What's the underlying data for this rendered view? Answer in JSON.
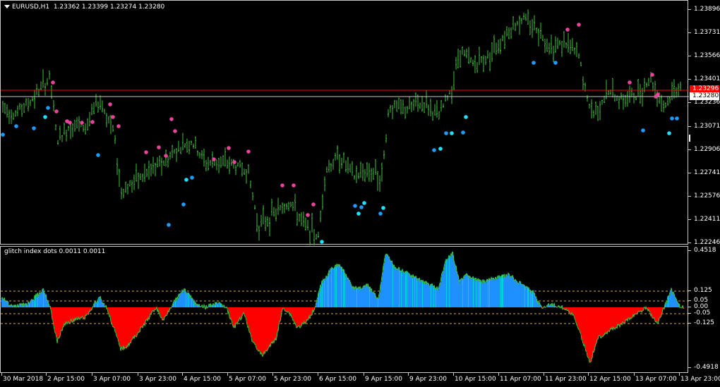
{
  "chart": {
    "symbol_label": "EURUSD,H1  1.23362 1.23399 1.23274 1.23280",
    "indicator_label": "glitch index dots 0.0011 0.0011",
    "bar_color": "#3cc33c",
    "colors": {
      "pink": "#e8449b",
      "blue": "#1e9bff",
      "cyan": "#1fe0ff",
      "bid_line": "#c8c8c8",
      "ask_line": "#ff0000",
      "hist_pos": "#1e90ff",
      "hist_pos_alt": "#00d0e0",
      "hist_neg": "#ff0000",
      "hist_line": "#3cc33c",
      "level_line": "#d9a441"
    },
    "price_ticks": [
      "1.23896",
      "1.23731",
      "1.23566",
      "1.23401",
      "1.23236",
      "1.23071",
      "1.22906",
      "1.22741",
      "1.22576",
      "1.22411",
      "1.22246"
    ],
    "ask_price": "1.23296",
    "bid_price": "1.23280",
    "indicator_ticks": [
      "0.4518",
      "0.125",
      "0.05",
      "0.00",
      "-0.05",
      "-0.125",
      "-0.4918"
    ],
    "time_labels": [
      "30 Mar 2018",
      "2 Apr 15:00",
      "3 Apr 07:00",
      "3 Apr 23:00",
      "4 Apr 15:00",
      "5 Apr 07:00",
      "5 Apr 23:00",
      "6 Apr 15:00",
      "9 Apr 15:00",
      "9 Apr 23:00",
      "10 Apr 15:00",
      "11 Apr 07:00",
      "11 Apr 23:00",
      "12 Apr 15:00",
      "13 Apr 07:00",
      "13 Apr 23:00"
    ]
  }
}
